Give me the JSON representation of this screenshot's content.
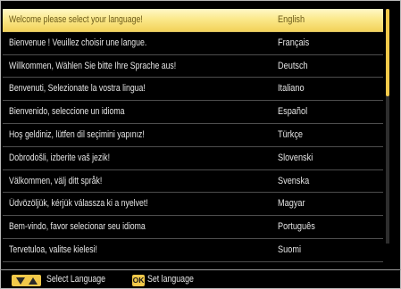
{
  "language_list": {
    "items": [
      {
        "prompt": "Welcome please select your language!",
        "language": "English",
        "selected": true
      },
      {
        "prompt": "Bienvenue ! Veuillez choisir une langue.",
        "language": "Français"
      },
      {
        "prompt": "Willkommen, Wählen Sie bitte Ihre Sprache aus!",
        "language": "Deutsch"
      },
      {
        "prompt": "Benvenuti, Selezionate la vostra lingua!",
        "language": "Italiano"
      },
      {
        "prompt": "Bienvenido, seleccione un idioma",
        "language": "Español"
      },
      {
        "prompt": "Hoş geldiniz, lütfen dil seçimini yapınız!",
        "language": "Türkçe"
      },
      {
        "prompt": "Dobrodošli, izberite vaš jezik!",
        "language": "Slovenski"
      },
      {
        "prompt": "Välkommen, välj ditt språk!",
        "language": "Svenska"
      },
      {
        "prompt": "Üdvözöljük, kérjük válassza ki a nyelvet!",
        "language": "Magyar"
      },
      {
        "prompt": "Bem-vindo, favor selecionar seu idioma",
        "language": "Português"
      },
      {
        "prompt": "Tervetuloa, valitse kielesi!",
        "language": "Suomi"
      }
    ]
  },
  "scrollbar": {
    "position_fraction": 0.0,
    "visible_fraction": 0.37,
    "thumb_color": "#f2c94a"
  },
  "footer": {
    "select_hint": "Select Language",
    "ok_key": "OK",
    "set_hint": "Set language"
  },
  "colors": {
    "background": "#000000",
    "highlight": "#f9e27e",
    "accent_key": "#f2c94a",
    "text": "#e6e6e6"
  }
}
